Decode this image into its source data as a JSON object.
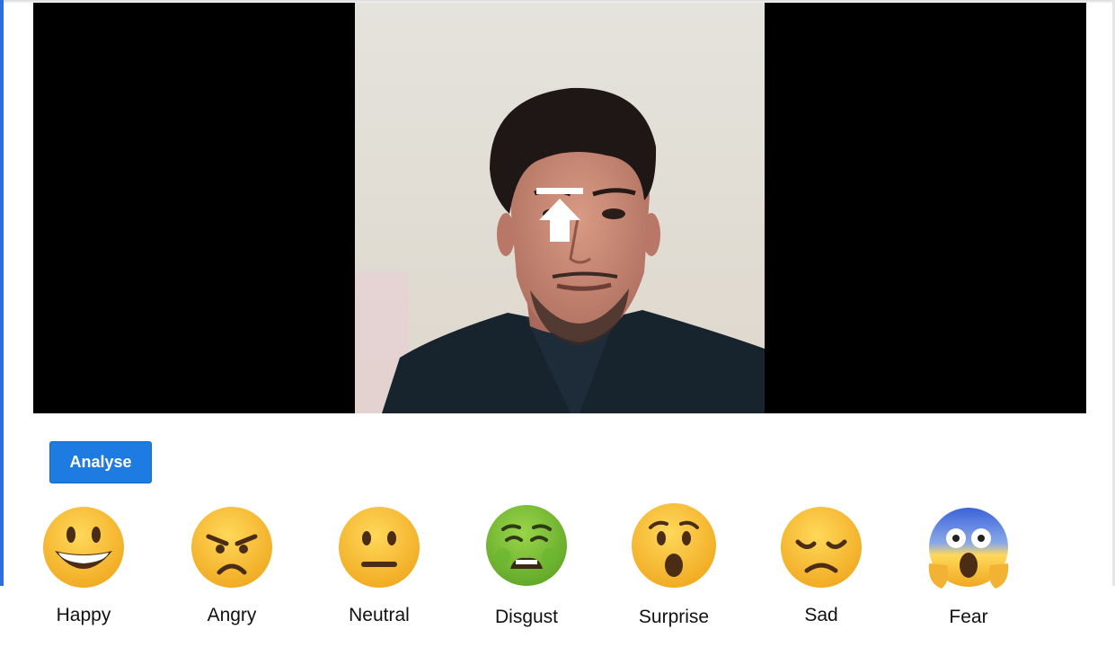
{
  "camera": {
    "feed_description_icon": "person-face-camera-feed",
    "overlay_icon": "upload-arrow-icon"
  },
  "controls": {
    "analyse_label": "Analyse",
    "button_color": "#1e7be1"
  },
  "emotions": [
    {
      "label": "Happy",
      "icon": "happy-emoji-icon"
    },
    {
      "label": "Angry",
      "icon": "angry-emoji-icon"
    },
    {
      "label": "Neutral",
      "icon": "neutral-emoji-icon"
    },
    {
      "label": "Disgust",
      "icon": "disgust-emoji-icon"
    },
    {
      "label": "Surprise",
      "icon": "surprise-emoji-icon"
    },
    {
      "label": "Sad",
      "icon": "sad-emoji-icon"
    },
    {
      "label": "Fear",
      "icon": "fear-emoji-icon"
    }
  ]
}
